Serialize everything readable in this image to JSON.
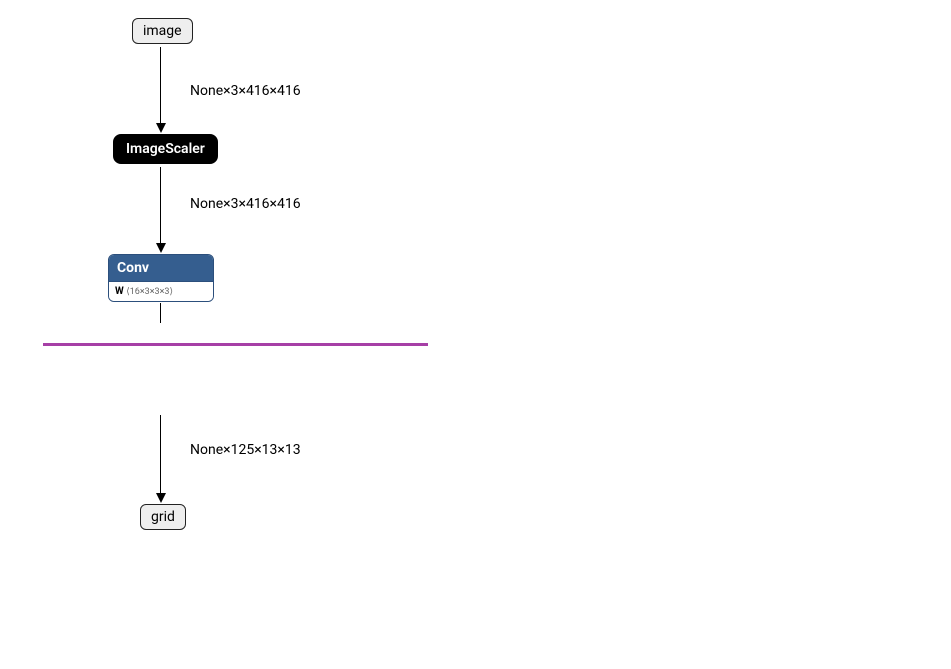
{
  "nodes": {
    "input": {
      "label": "image"
    },
    "scaler": {
      "label": "ImageScaler"
    },
    "conv": {
      "title": "Conv",
      "param_name": "W",
      "param_dims": "⟨16×3×3×3⟩"
    },
    "output": {
      "label": "grid"
    }
  },
  "edges": {
    "e1": {
      "label": "None×3×416×416"
    },
    "e2": {
      "label": "None×3×416×416"
    },
    "e3": {
      "label": "None×125×13×13"
    }
  }
}
